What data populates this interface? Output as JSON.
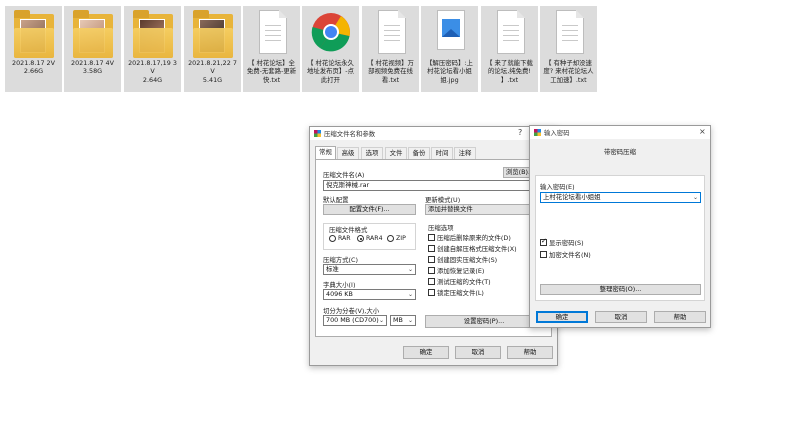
{
  "desktop": {
    "files": [
      {
        "name": "2021.8.17 2V\n2.66G",
        "type": "folder"
      },
      {
        "name": "2021.8.17 4V\n3.58G",
        "type": "folder"
      },
      {
        "name": "2021.8.17,19 3V\n2.64G",
        "type": "folder"
      },
      {
        "name": "2021.8.21,22 7V\n5.41G",
        "type": "folder"
      },
      {
        "name": "【 村花论坛】全免费-无套路-更新快.txt",
        "type": "txt"
      },
      {
        "name": "【 村花论坛永久地址发布页】-点此打开",
        "type": "chrome"
      },
      {
        "name": "【 村花视频】万部视频免费在线看.txt",
        "type": "txt"
      },
      {
        "name": "【解压密码】:上村花论坛看小姐姐.jpg",
        "type": "jpg"
      },
      {
        "name": "【 来了就能下载的论坛,纯免费! 】.txt",
        "type": "txt"
      },
      {
        "name": "【 有种子却没速度? 来村花论坛人工加速】.txt",
        "type": "txt"
      }
    ]
  },
  "archive_dialog": {
    "title": "压缩文件名和参数",
    "help_glyph": "?",
    "close_glyph": "×",
    "tabs": [
      "常规",
      "高级",
      "选项",
      "文件",
      "备份",
      "时间",
      "注释"
    ],
    "archive_name_label": "压缩文件名(A)",
    "archive_name_value": "倪克斯神械.rar",
    "browse_button": "浏览(B)...",
    "default_profile_label": "默认配置",
    "profiles_button": "配置文件(F)...",
    "update_mode_label": "更新模式(U)",
    "update_mode_value": "添加并替换文件",
    "format_group_label": "压缩文件格式",
    "formats": [
      "RAR",
      "RAR4",
      "ZIP"
    ],
    "selected_format": "RAR4",
    "method_label": "压缩方式(C)",
    "method_value": "标准",
    "dict_label": "字典大小(I)",
    "dict_value": "4096 KB",
    "split_label": "切分为分卷(V),大小",
    "split_value": "700 MB  (CD700)",
    "split_unit": "MB",
    "options_label": "压缩选项",
    "options": [
      {
        "label": "压缩后删除原来的文件(D)",
        "checked": false
      },
      {
        "label": "创建自解压格式压缩文件(X)",
        "checked": false
      },
      {
        "label": "创建固实压缩文件(S)",
        "checked": false
      },
      {
        "label": "添加恢复记录(E)",
        "checked": false
      },
      {
        "label": "测试压缩的文件(T)",
        "checked": false
      },
      {
        "label": "锁定压缩文件(L)",
        "checked": false
      }
    ],
    "set_password_button": "设置密码(P)...",
    "ok_button": "确定",
    "cancel_button": "取消",
    "help_button": "帮助"
  },
  "password_dialog": {
    "title": "输入密码",
    "close_glyph": "×",
    "heading": "带密码压缩",
    "password_label": "输入密码(E)",
    "password_value": "上村花论坛看小姐姐",
    "show_password_label": "显示密码(S)",
    "show_password_checked": true,
    "encrypt_names_label": "加密文件名(N)",
    "encrypt_names_checked": false,
    "organize_button": "整理密码(O)...",
    "ok_button": "确定",
    "cancel_button": "取消",
    "help_button": "帮助"
  },
  "colors": {
    "folder": "#e8b43a",
    "accent": "#0078d7",
    "tile_bg": "#dcdcdc"
  }
}
